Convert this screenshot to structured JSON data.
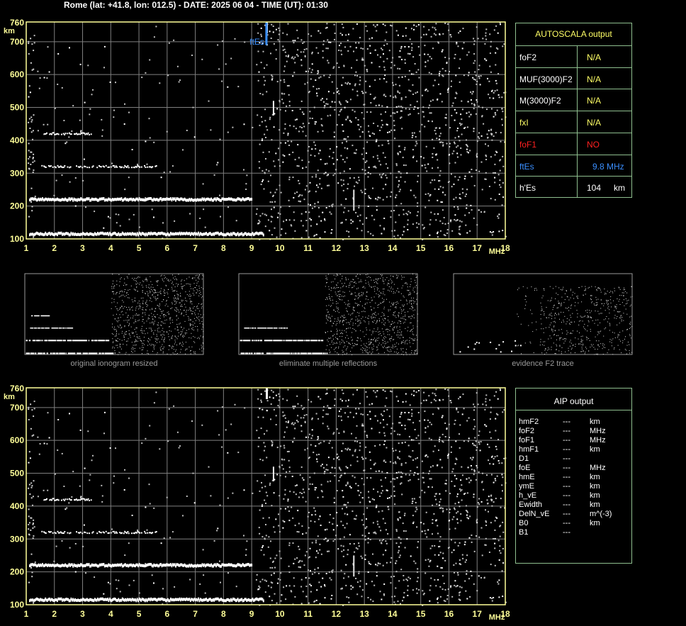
{
  "header": "Rome (lat: +41.8, lon: 012.5) - DATE: 2025 06 04 - TIME (UT): 01:30",
  "colors": {
    "frame": "#ffff99",
    "grid": "#7f7f7f",
    "axis_text": "#ffff99",
    "table_border": "#8fbf8f",
    "red": "#ff2020",
    "blue": "#3a8fff",
    "yellow": "#ffff66"
  },
  "chart_data": [
    {
      "type": "scatter",
      "name": "main",
      "xlabel": "MHz",
      "ylabel": "km",
      "xlim": [
        1,
        18
      ],
      "ylim": [
        100,
        760
      ],
      "x_ticks": [
        "1",
        "2",
        "3",
        "4",
        "5",
        "6",
        "7",
        "8",
        "9",
        "10",
        "11",
        "12",
        "13",
        "14",
        "15",
        "16",
        "17",
        "18"
      ],
      "y_ticks": [
        "100",
        "200",
        "300",
        "400",
        "500",
        "600",
        "700",
        "760"
      ],
      "traces": [
        {
          "name": "E layer",
          "x_from": 1.1,
          "x_to": 9.4,
          "y": 115
        },
        {
          "name": "2nd reflection",
          "x_from": 1.1,
          "x_to": 9.0,
          "y": 220
        },
        {
          "name": "3rd reflection",
          "x_from": 1.5,
          "x_to": 5.6,
          "y": 320
        },
        {
          "name": "4th reflection",
          "x_from": 1.6,
          "x_to": 3.3,
          "y": 420
        }
      ],
      "ftEs_marker": {
        "label": "ftEs",
        "x": 9.8
      }
    },
    {
      "type": "scatter",
      "name": "aip",
      "xlabel": "MHz",
      "ylabel": "km",
      "xlim": [
        1,
        18
      ],
      "ylim": [
        100,
        760
      ],
      "x_ticks": [
        "1",
        "2",
        "3",
        "4",
        "5",
        "6",
        "7",
        "8",
        "9",
        "10",
        "11",
        "12",
        "13",
        "14",
        "15",
        "16",
        "17",
        "18"
      ],
      "y_ticks": [
        "100",
        "200",
        "300",
        "400",
        "500",
        "600",
        "700",
        "760"
      ]
    }
  ],
  "thumbnails": [
    {
      "caption": "original ionogram resized"
    },
    {
      "caption": "eliminate multiple reflections"
    },
    {
      "caption": "evidence F2 trace"
    }
  ],
  "autoscala": {
    "title": "AUTOSCALA output",
    "rows": [
      {
        "name": "foF2",
        "value": "N/A",
        "unit": ""
      },
      {
        "name": "MUF(3000)F2",
        "value": "N/A",
        "unit": ""
      },
      {
        "name": "M(3000)F2",
        "value": "N/A",
        "unit": ""
      },
      {
        "name": "fxI",
        "value": "N/A",
        "unit": ""
      },
      {
        "name": "foF1",
        "value": "NO",
        "unit": ""
      },
      {
        "name": "ftEs",
        "value": "9.8",
        "unit": "MHz"
      },
      {
        "name": "h'Es",
        "value": "104",
        "unit": "km"
      }
    ]
  },
  "aip": {
    "title": "AIP output",
    "rows": [
      {
        "name": "hmF2",
        "value": "---",
        "unit": "km"
      },
      {
        "name": "foF2",
        "value": "---",
        "unit": "MHz"
      },
      {
        "name": "foF1",
        "value": "---",
        "unit": "MHz"
      },
      {
        "name": "hmF1",
        "value": "---",
        "unit": "km"
      },
      {
        "name": "D1",
        "value": "---",
        "unit": ""
      },
      {
        "name": "foE",
        "value": "---",
        "unit": "MHz"
      },
      {
        "name": "hmE",
        "value": "---",
        "unit": "km"
      },
      {
        "name": "ymE",
        "value": "---",
        "unit": "km"
      },
      {
        "name": "h_vE",
        "value": "---",
        "unit": "km"
      },
      {
        "name": "Ewidth",
        "value": "---",
        "unit": "km"
      },
      {
        "name": "DelN_vE",
        "value": "---",
        "unit": "m^(-3)"
      },
      {
        "name": "B0",
        "value": "---",
        "unit": "km"
      },
      {
        "name": "B1",
        "value": "---",
        "unit": ""
      }
    ]
  }
}
